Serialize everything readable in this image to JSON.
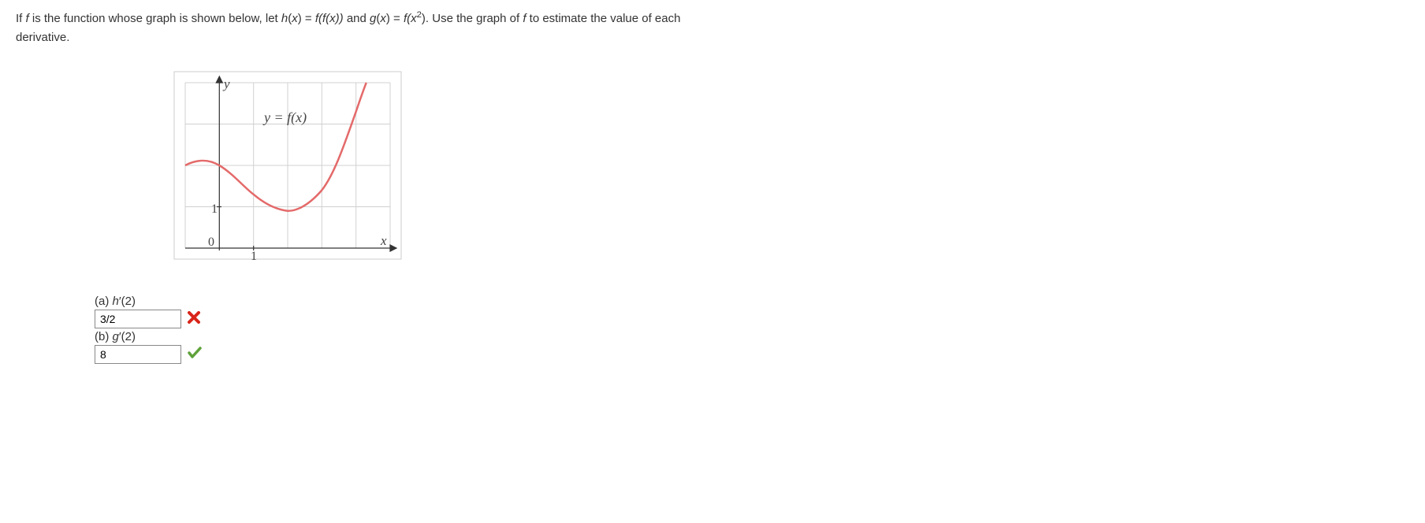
{
  "problem": {
    "line1_pre": "If ",
    "f": "f",
    "line1_mid1": " is the function whose graph is shown below, let ",
    "hx": "h",
    "xvar": "x",
    "eq": " = ",
    "ffx": "f(f(x))",
    "and": " and ",
    "gx": "g",
    "fx2_pre": "f(",
    "fx2_exp": "2",
    "fx2_post": ")",
    "line1_end": ". Use the graph of ",
    "line1_tail": " to estimate the value of each",
    "line2": "derivative."
  },
  "graph": {
    "y_label": "y",
    "x_label": "x",
    "curve_label": "y = f(x)",
    "tick1": "1",
    "tick0": "0"
  },
  "answers": {
    "a": {
      "label_pre": "(a) ",
      "label_fn": "h",
      "label_prime": "′(2)",
      "value": "3/2",
      "status": "wrong"
    },
    "b": {
      "label_pre": "(b) ",
      "label_fn": "g",
      "label_prime": "′(2)",
      "value": "8",
      "status": "correct"
    }
  },
  "chart_data": {
    "type": "line",
    "title": "y = f(x)",
    "xlabel": "x",
    "ylabel": "y",
    "xlim": [
      -1,
      5
    ],
    "ylim": [
      0,
      4
    ],
    "series": [
      {
        "name": "f(x)",
        "x": [
          -1,
          -0.5,
          0,
          0.5,
          1,
          1.5,
          2,
          2.5,
          3,
          3.5,
          4,
          4.3
        ],
        "y": [
          2.0,
          2.1,
          2.0,
          1.7,
          1.3,
          1.0,
          0.9,
          1.0,
          1.4,
          2.2,
          3.3,
          4.0
        ]
      }
    ],
    "ticks_x": [
      1
    ],
    "ticks_y": [
      1
    ],
    "grid": true
  }
}
